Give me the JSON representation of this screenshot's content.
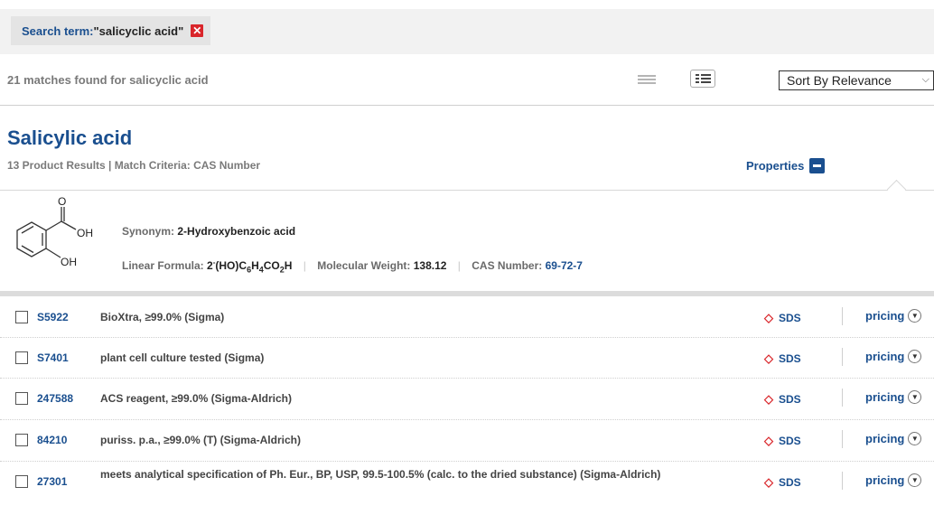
{
  "search": {
    "label": "Search term:",
    "term": "\"salicyclic acid\"",
    "close_glyph": "✕"
  },
  "results": {
    "count_text": "21 matches found for salicyclic acid",
    "sort_value": "Sort By Relevance"
  },
  "product": {
    "title": "Salicylic acid",
    "subtitle": "13 Product Results  |  Match Criteria: CAS Number",
    "properties_label": "Properties",
    "synonym_label": "Synonym:",
    "synonym_value": "2-Hydroxybenzoic acid",
    "linear_formula_label": "Linear Formula:",
    "mw_label": "Molecular Weight:",
    "mw_value": "138.12",
    "cas_label": "CAS Number:",
    "cas_value": "69-72-7",
    "structure_labels": {
      "o": "O",
      "oh1": "OH",
      "oh2": "OH"
    }
  },
  "table": {
    "rows": [
      {
        "code": "S5922",
        "desc": "BioXtra, ≥99.0% (Sigma)",
        "sds": "SDS",
        "pricing": "pricing"
      },
      {
        "code": "S7401",
        "desc": "plant cell culture tested (Sigma)",
        "sds": "SDS",
        "pricing": "pricing"
      },
      {
        "code": "247588",
        "desc": "ACS reagent, ≥99.0% (Sigma-Aldrich)",
        "sds": "SDS",
        "pricing": "pricing"
      },
      {
        "code": "84210",
        "desc": "puriss. p.a., ≥99.0% (T) (Sigma-Aldrich)",
        "sds": "SDS",
        "pricing": "pricing"
      },
      {
        "code": "27301",
        "desc": "meets analytical specification of Ph. Eur., BP, USP, 99.5-100.5% (calc. to the dried substance) (Sigma-Aldrich)",
        "sds": "SDS",
        "pricing": "pricing"
      }
    ]
  },
  "colors": {
    "link_blue": "#1a4f8f",
    "accent_red": "#d9252a",
    "search_bg": "#f2f2f2"
  },
  "icons": {
    "close": "close-icon",
    "list_view": "list-view-icon",
    "detail_view": "detail-view-icon",
    "sort_chevron": "chevron-down-icon",
    "properties_toggle": "minus-box-icon",
    "sds_marker": "diamond-icon",
    "pricing_expand": "chevron-circle-down-icon"
  }
}
